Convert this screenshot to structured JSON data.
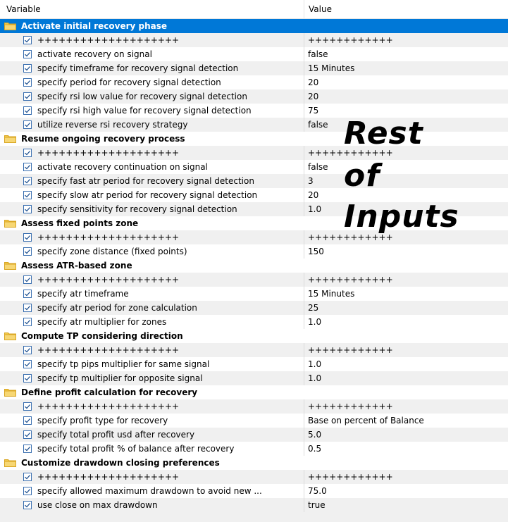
{
  "header": {
    "variable_label": "Variable",
    "value_label": "Value"
  },
  "rows": [
    {
      "type": "group",
      "label": "Activate initial recovery phase",
      "selected": true
    },
    {
      "type": "item",
      "label": "++++++++++++++++++++",
      "value": "++++++++++++"
    },
    {
      "type": "item",
      "label": "activate recovery on signal",
      "value": "false"
    },
    {
      "type": "item",
      "label": "specify timeframe for recovery signal detection",
      "value": "15 Minutes"
    },
    {
      "type": "item",
      "label": "specify period for recovery signal detection",
      "value": "20"
    },
    {
      "type": "item",
      "label": "specify rsi low value for recovery signal detection",
      "value": "20"
    },
    {
      "type": "item",
      "label": "specify rsi high value for recovery signal detection",
      "value": "75"
    },
    {
      "type": "item",
      "label": "utilize reverse rsi recovery strategy",
      "value": "false"
    },
    {
      "type": "group",
      "label": "Resume ongoing recovery process"
    },
    {
      "type": "item",
      "label": "++++++++++++++++++++",
      "value": "++++++++++++"
    },
    {
      "type": "item",
      "label": "activate recovery continuation on signal",
      "value": "false"
    },
    {
      "type": "item",
      "label": "specify fast atr period for recovery signal detection",
      "value": "3"
    },
    {
      "type": "item",
      "label": "specify slow atr period for recovery signal detection",
      "value": "20"
    },
    {
      "type": "item",
      "label": "specify sensitivity for recovery signal detection",
      "value": "1.0"
    },
    {
      "type": "group",
      "label": "Assess fixed points zone"
    },
    {
      "type": "item",
      "label": "++++++++++++++++++++",
      "value": "++++++++++++"
    },
    {
      "type": "item",
      "label": "specify zone distance (fixed points)",
      "value": "150"
    },
    {
      "type": "group",
      "label": "Assess ATR-based zone"
    },
    {
      "type": "item",
      "label": "++++++++++++++++++++",
      "value": "++++++++++++"
    },
    {
      "type": "item",
      "label": "specify atr timeframe",
      "value": "15 Minutes"
    },
    {
      "type": "item",
      "label": "specify atr period for zone calculation",
      "value": "25"
    },
    {
      "type": "item",
      "label": "specify atr multiplier for zones",
      "value": "1.0"
    },
    {
      "type": "group",
      "label": "Compute TP considering direction"
    },
    {
      "type": "item",
      "label": "++++++++++++++++++++",
      "value": "++++++++++++"
    },
    {
      "type": "item",
      "label": "specify tp pips multiplier for same signal",
      "value": "1.0"
    },
    {
      "type": "item",
      "label": "specify tp multiplier for opposite signal",
      "value": "1.0"
    },
    {
      "type": "group",
      "label": "Define profit calculation for recovery"
    },
    {
      "type": "item",
      "label": "++++++++++++++++++++",
      "value": "++++++++++++"
    },
    {
      "type": "item",
      "label": "specify profit type for recovery",
      "value": "Base on percent of Balance"
    },
    {
      "type": "item",
      "label": "specify total profit usd after recovery",
      "value": "5.0"
    },
    {
      "type": "item",
      "label": "specify total profit % of balance after recovery",
      "value": "0.5"
    },
    {
      "type": "group",
      "label": "Customize drawdown closing preferences"
    },
    {
      "type": "item",
      "label": "++++++++++++++++++++",
      "value": "++++++++++++"
    },
    {
      "type": "item",
      "label": "specify allowed maximum drawdown to avoid new ...",
      "value": "75.0"
    },
    {
      "type": "item",
      "label": "use close on max drawdown",
      "value": "true"
    }
  ],
  "overlay": {
    "line1": "Rest",
    "line2": "of",
    "line3": "Inputs"
  },
  "colors": {
    "selected_row": "#0078d7",
    "alt_row": "#f0f0f0",
    "checkbox_border": "#3a6fb0",
    "folder_fill": "#f2c94c",
    "folder_edge": "#d9a520"
  },
  "icons": {
    "group": "folder-icon",
    "item": "checkbox-checked-icon"
  }
}
